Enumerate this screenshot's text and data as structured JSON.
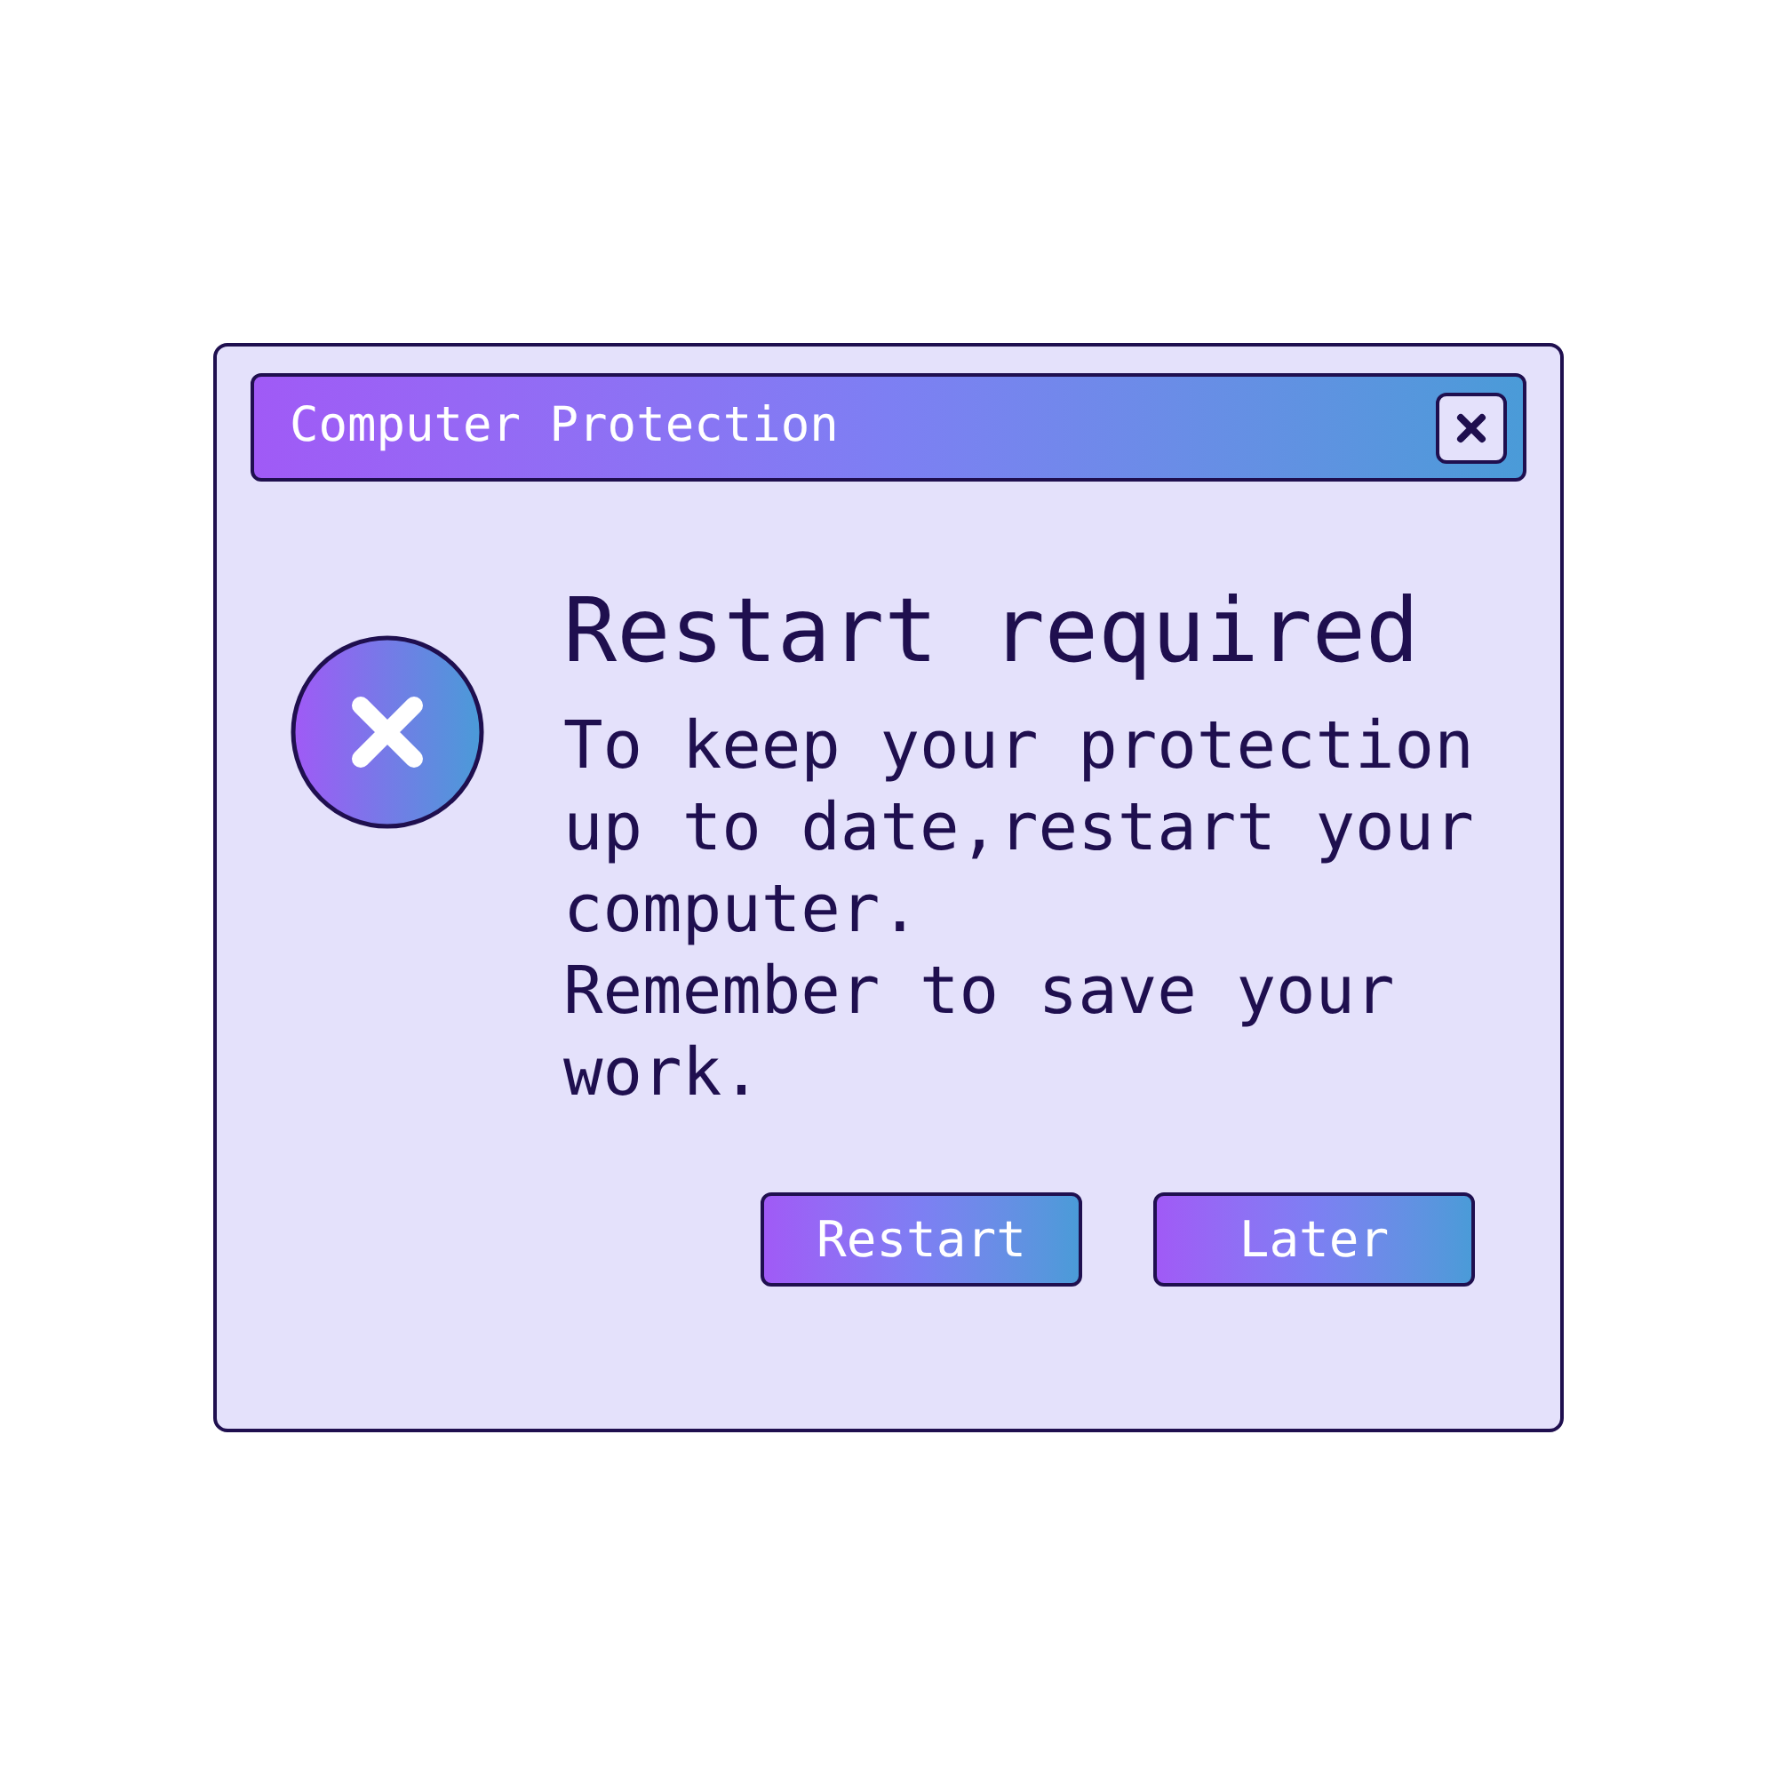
{
  "window": {
    "title": "Computer Protection"
  },
  "message": {
    "heading": "Restart required",
    "paragraphs": [
      "To keep your protection up to date,restart your computer.",
      "Remember to save your work."
    ]
  },
  "buttons": [
    "Restart",
    "Later"
  ]
}
